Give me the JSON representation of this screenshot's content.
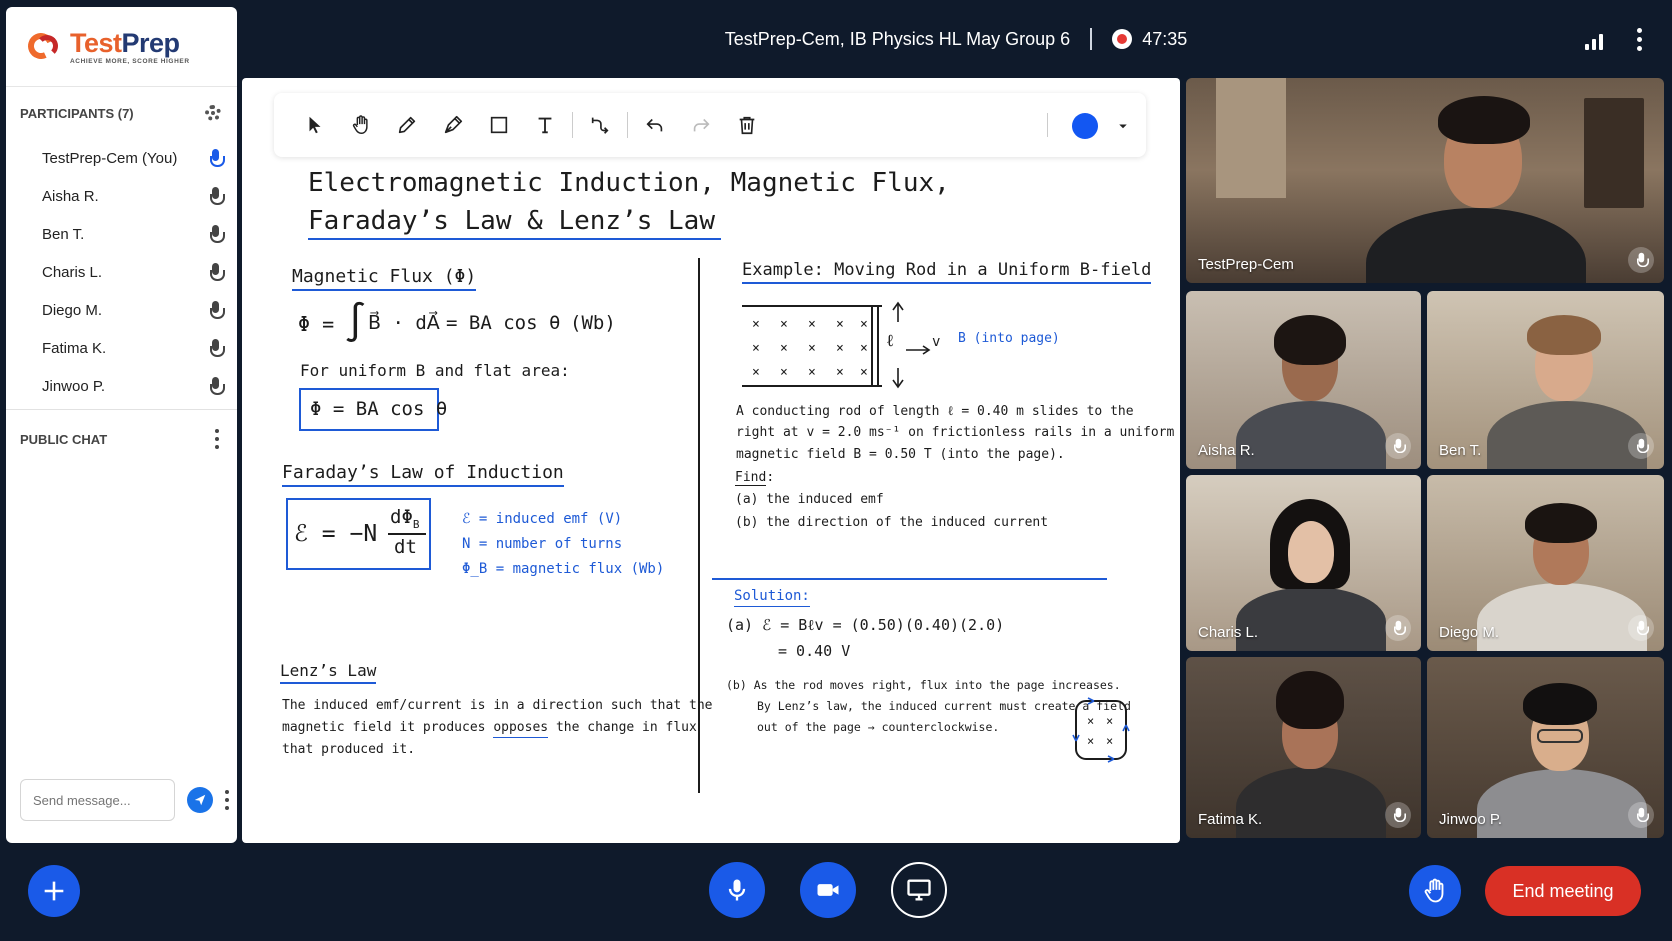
{
  "app": {
    "logo_text_1": "Test",
    "logo_text_2": "Prep",
    "logo_tagline": "ACHIEVE MORE, SCORE HIGHER"
  },
  "header": {
    "meeting_title": "TestPrep-Cem, IB Physics HL May Group 6",
    "record_time": "47:35"
  },
  "participants": {
    "heading": "PARTICIPANTS (7)",
    "items": [
      {
        "name": "TestPrep-Cem (You)",
        "speaking": true
      },
      {
        "name": "Aisha R.",
        "speaking": false
      },
      {
        "name": "Ben T.",
        "speaking": false
      },
      {
        "name": "Charis L.",
        "speaking": false
      },
      {
        "name": "Diego M.",
        "speaking": false
      },
      {
        "name": "Fatima K.",
        "speaking": false
      },
      {
        "name": "Jinwoo P.",
        "speaking": false
      }
    ]
  },
  "chat": {
    "heading": "PUBLIC CHAT",
    "placeholder": "Send message..."
  },
  "toolbar": {
    "tools": [
      "select-icon",
      "hand-icon",
      "pencil-icon",
      "pen-icon",
      "rectangle-icon",
      "text-icon",
      "connector-icon",
      "undo-icon",
      "redo-icon",
      "trash-icon"
    ],
    "selected_color": "#1357f2"
  },
  "board": {
    "title_line1": "Electromagnetic Induction, Magnetic Flux,",
    "title_line2": "Faraday’s Law & Lenz’s Law",
    "flux": {
      "heading": "Magnetic Flux (Φ)",
      "eq1_lhs": "Φ =",
      "eq1_int": "∫",
      "eq1_body": "B⃗ · dA⃗",
      "eq1_rhs": "= BA cos θ",
      "eq1_unit": "(Wb)",
      "uniform_note": "For uniform B and flat area:",
      "boxed": "Φ = BA cos θ"
    },
    "faraday": {
      "heading": "Faraday’s Law of Induction",
      "emf_lhs": "ℰ = −N",
      "emf_num": "dΦ",
      "emf_num_sub": "B",
      "emf_den": "dt",
      "legend": [
        "ℰ = induced emf (V)",
        "N = number of turns",
        "Φ_B = magnetic flux (Wb)"
      ]
    },
    "lenz": {
      "heading": "Lenz’s Law",
      "line1": "The induced emf/current is in a direction such that the",
      "line2_a": "magnetic field it produces",
      "line2_b": "opposes",
      "line2_c": "the change in flux",
      "line3": "that produced it."
    },
    "example": {
      "heading": "Example: Moving Rod in a Uniform B-field",
      "ell_label": "ℓ",
      "v_label": "v",
      "b_label": "B (into page)",
      "problem_line1": "A conducting rod of length ℓ = 0.40 m slides to the",
      "problem_line2": "right at v = 2.0 ms⁻¹ on frictionless rails in a uniform",
      "problem_line3": "magnetic field B = 0.50 T (into the page).",
      "find_label": "Find",
      "find_a": "(a) the induced emf",
      "find_b": "(b) the direction of the induced current"
    },
    "solution": {
      "heading": "Solution:",
      "a_line1": "(a)  ℰ = Bℓv = (0.50)(0.40)(2.0)",
      "a_line2": "= 0.40 V",
      "b_line1": "(b)  As the rod moves right, flux into the page increases.",
      "b_line2": "By Lenz’s law, the induced current must create a field",
      "b_line3": "out of the page → counterclockwise."
    }
  },
  "videos": [
    {
      "name": "TestPrep-Cem"
    },
    {
      "name": "Aisha R."
    },
    {
      "name": "Ben T."
    },
    {
      "name": "Charis L."
    },
    {
      "name": "Diego M."
    },
    {
      "name": "Fatima K."
    },
    {
      "name": "Jinwoo P."
    }
  ],
  "controls": {
    "end_meeting": "End meeting",
    "accent": "#1a5ae8",
    "end_color": "#d93025"
  }
}
